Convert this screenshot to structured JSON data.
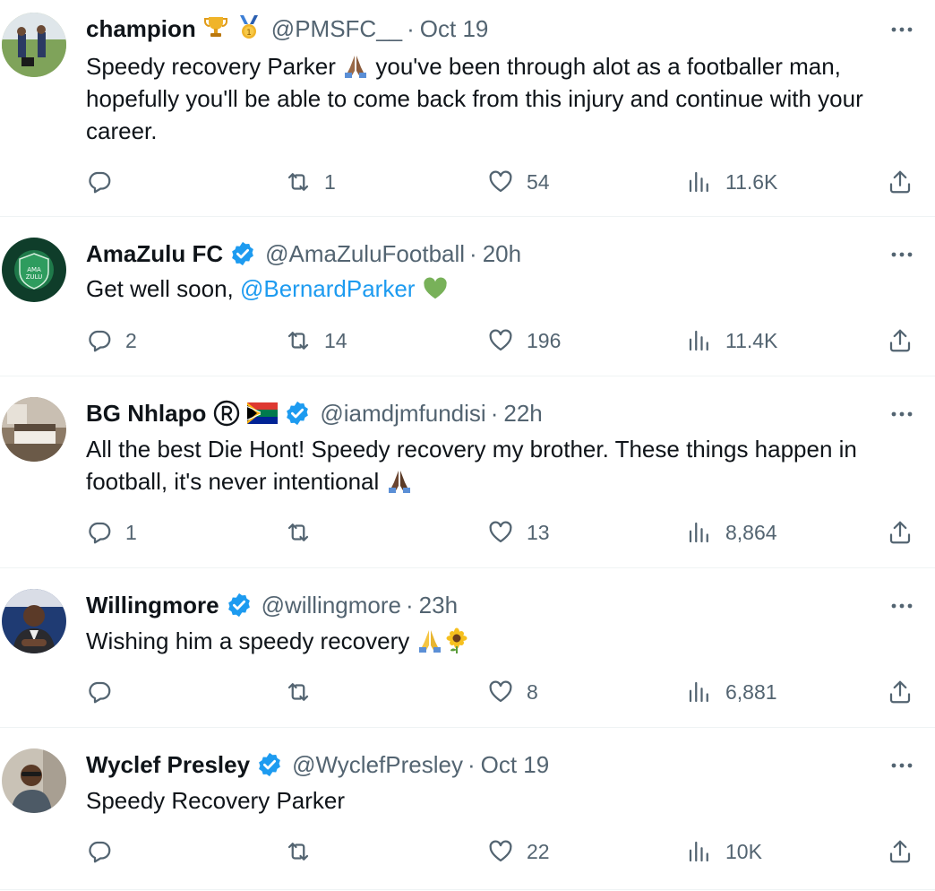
{
  "tweets": [
    {
      "name": "champion",
      "handle": "@PMSFC__",
      "time": "Oct 19",
      "text_before": "Speedy recovery Parker",
      "text_after": " you've been through alot as a footballer man, hopefully you'll be able to come back from this injury and continue with your career.",
      "name_emojis": [
        "trophy-icon",
        "medal-icon"
      ],
      "replies": "",
      "reposts": "1",
      "likes": "54",
      "views": "11.6K"
    },
    {
      "name": "AmaZulu FC",
      "handle": "@AmaZuluFootball",
      "time": "20h",
      "text_before": "Get well soon, ",
      "mention": "@BernardParker",
      "verified": true,
      "replies": "2",
      "reposts": "14",
      "likes": "196",
      "views": "11.4K"
    },
    {
      "name": "BG Nhlapo",
      "handle": "@iamdjmfundisi",
      "time": "22h",
      "text_before": "All the best Die Hont! Speedy recovery my brother. These things happen in football, it's never intentional",
      "verified": true,
      "replies": "1",
      "reposts": "",
      "likes": "13",
      "views": "8,864"
    },
    {
      "name": "Willingmore",
      "handle": "@willingmore",
      "time": "23h",
      "text_before": "Wishing him a speedy recovery",
      "verified": true,
      "replies": "",
      "reposts": "",
      "likes": "8",
      "views": "6,881"
    },
    {
      "name": "Wyclef Presley",
      "handle": "@WyclefPresley",
      "time": "Oct 19",
      "text_before": "Speedy Recovery Parker",
      "verified": true,
      "replies": "",
      "reposts": "",
      "likes": "22",
      "views": "10K"
    }
  ],
  "separator": "·",
  "colors": {
    "text": "#0f1419",
    "muted": "#536471",
    "link": "#1d9bf0",
    "verified": "#1d9bf0",
    "divider": "#eff3f4"
  }
}
